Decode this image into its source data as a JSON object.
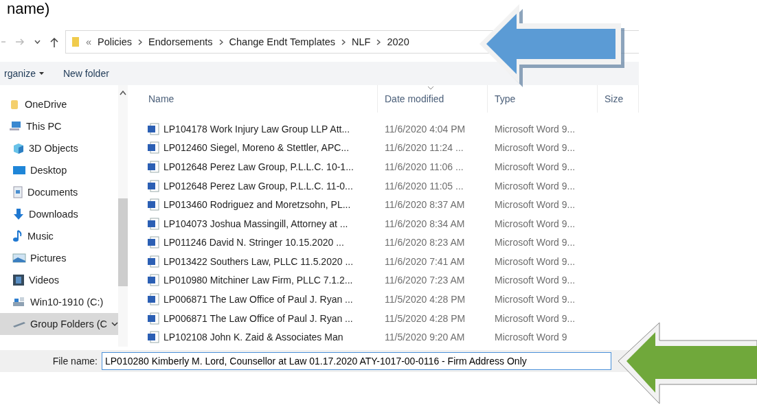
{
  "heading_fragment": "name)",
  "address_bar": {
    "overflow": "«",
    "crumbs": [
      "Policies",
      "Endorsements",
      "Change Endt Templates",
      "NLF",
      "2020"
    ]
  },
  "toolbar": {
    "items": [
      {
        "label": "rganize",
        "dropdown": true
      },
      {
        "label": "New folder",
        "dropdown": false
      }
    ]
  },
  "sidebar": {
    "items": [
      {
        "label": "OneDrive",
        "kind": "cloud",
        "selected": false
      },
      {
        "label": "This PC",
        "kind": "pc",
        "selected": false,
        "children": [
          {
            "label": "3D Objects",
            "kind": "cube",
            "selected": false
          },
          {
            "label": "Desktop",
            "kind": "desktop",
            "selected": false
          },
          {
            "label": "Documents",
            "kind": "documents",
            "selected": false
          },
          {
            "label": "Downloads",
            "kind": "downloads",
            "selected": false
          },
          {
            "label": "Music",
            "kind": "music",
            "selected": false
          },
          {
            "label": "Pictures",
            "kind": "pictures",
            "selected": false
          },
          {
            "label": "Videos",
            "kind": "videos",
            "selected": false
          },
          {
            "label": "Win10-1910 (C:)",
            "kind": "drive",
            "selected": false
          },
          {
            "label": "Group Folders (C",
            "kind": "network",
            "selected": true,
            "expandable": true
          }
        ]
      }
    ]
  },
  "table": {
    "columns": [
      {
        "label": "Name",
        "sorted": false
      },
      {
        "label": "Date modified",
        "sorted": true
      },
      {
        "label": "Type",
        "sorted": false
      },
      {
        "label": "Size",
        "sorted": false
      }
    ],
    "rows": [
      [
        "LP104178 Work Injury Law Group LLP Att...",
        "11/6/2020 4:04 PM",
        "Microsoft Word 9..."
      ],
      [
        "LP012460 Siegel, Moreno & Stettler, APC...",
        "11/6/2020 11:24 ...",
        "Microsoft Word 9..."
      ],
      [
        "LP012648 Perez Law Group, P.L.L.C. 10-1...",
        "11/6/2020 11:06 ...",
        "Microsoft Word 9..."
      ],
      [
        "LP012648 Perez Law Group, P.L.L.C. 11-0...",
        "11/6/2020 11:05 ...",
        "Microsoft Word 9..."
      ],
      [
        "LP013460 Rodriguez and Moretzsohn, PL...",
        "11/6/2020 8:37 AM",
        "Microsoft Word 9..."
      ],
      [
        "LP104073 Joshua Massingill, Attorney at ...",
        "11/6/2020 8:34 AM",
        "Microsoft Word 9..."
      ],
      [
        "LP011246 David N. Stringer 10.15.2020 ...",
        "11/6/2020 8:23 AM",
        "Microsoft Word 9..."
      ],
      [
        "LP013422 Southers Law, PLLC 11.5.2020 ...",
        "11/6/2020 7:41 AM",
        "Microsoft Word 9..."
      ],
      [
        "LP010980 Mitchiner Law Firm, PLLC 7.1.2...",
        "11/6/2020 7:23 AM",
        "Microsoft Word 9..."
      ],
      [
        "LP006871 The Law Office of Paul J. Ryan ...",
        "11/5/2020 4:28 PM",
        "Microsoft Word 9..."
      ],
      [
        "LP006871 The Law Office of Paul J. Ryan ...",
        "11/5/2020 4:28 PM",
        "Microsoft Word 9..."
      ],
      [
        "LP102108 John K. Zaid & Associates Man",
        "11/5/2020 9:20 AM",
        "Microsoft Word 9"
      ]
    ]
  },
  "file_name": {
    "label": "File name:",
    "value": "LP010280 Kimberly M. Lord, Counsellor at Law 01.17.2020 ATY-1017-00-0116 - Firm Address Only"
  },
  "callouts": [
    {
      "kind": "arrow",
      "color": "#5b9bd5"
    },
    {
      "kind": "arrow",
      "color": "#70a83b"
    }
  ]
}
